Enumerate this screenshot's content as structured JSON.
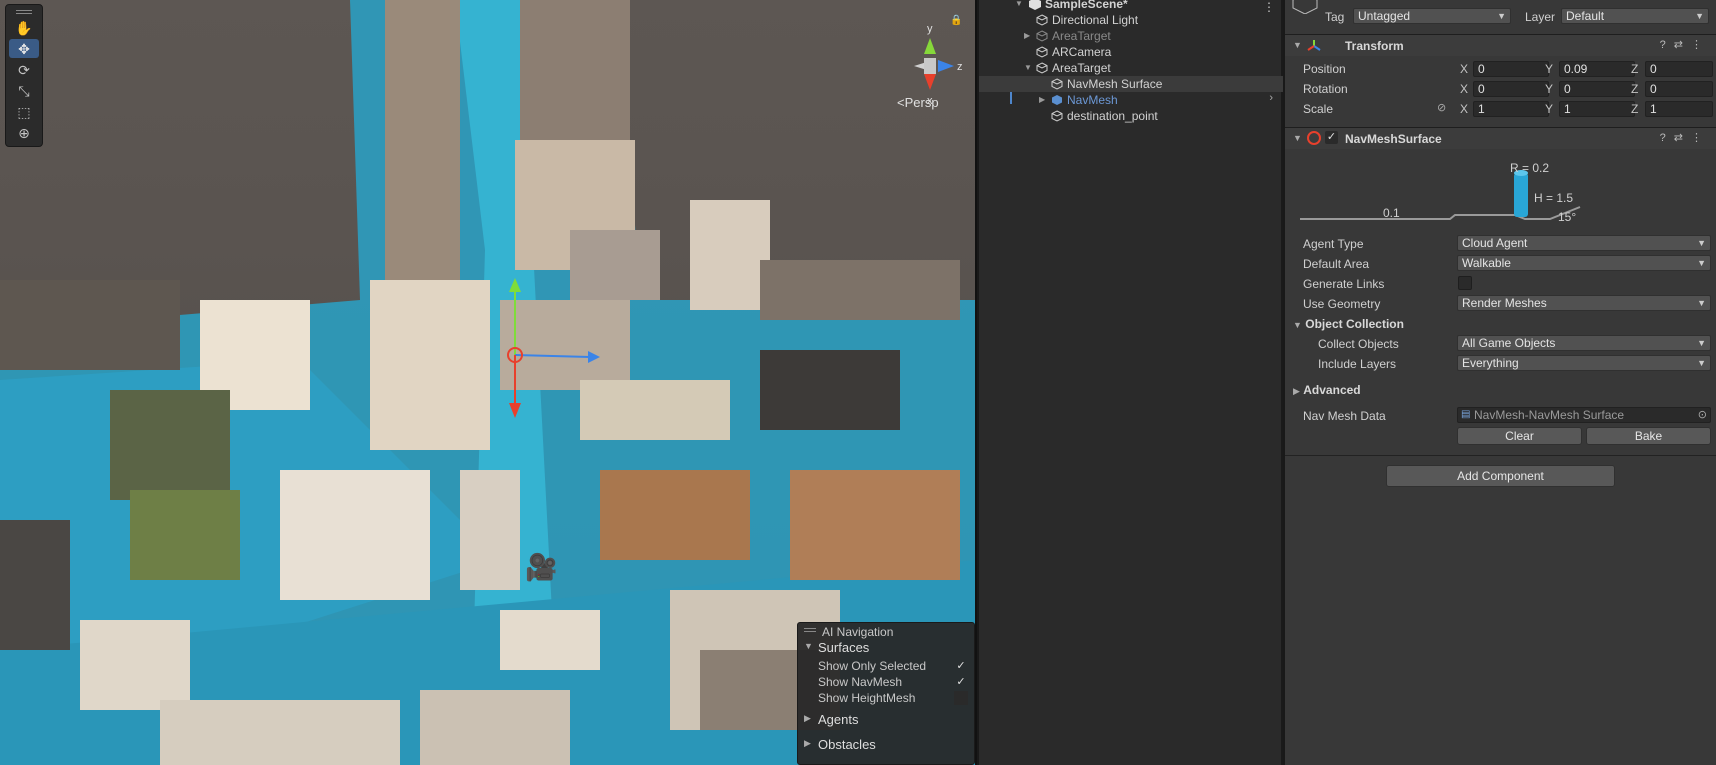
{
  "scene": {
    "tools": [
      "hand-tool",
      "move-tool",
      "rotate-tool",
      "scale-tool",
      "rect-tool",
      "transform-tool"
    ],
    "active_tool": "move-tool",
    "persp_label": "Persp",
    "gizmo_axes": {
      "y": "y",
      "z": "z",
      "x": "x"
    },
    "ai_navigation": {
      "title": "AI Navigation",
      "surfaces_label": "Surfaces",
      "rows": [
        {
          "label": "Show Only Selected",
          "checked": true
        },
        {
          "label": "Show NavMesh",
          "checked": true
        },
        {
          "label": "Show HeightMesh",
          "checked": false
        }
      ],
      "agents_label": "Agents",
      "obstacles_label": "Obstacles"
    }
  },
  "hierarchy": {
    "scene_name": "SampleScene*",
    "items": [
      {
        "label": "Directional Light"
      },
      {
        "label": "AreaTarget"
      },
      {
        "label": "ARCamera"
      },
      {
        "label": "AreaTarget"
      },
      {
        "label": "NavMesh Surface"
      },
      {
        "label": "NavMesh"
      },
      {
        "label": "destination_point"
      }
    ]
  },
  "inspector": {
    "tag_label": "Tag",
    "tag_value": "Untagged",
    "layer_label": "Layer",
    "layer_value": "Default",
    "transform": {
      "title": "Transform",
      "position_label": "Position",
      "rotation_label": "Rotation",
      "scale_label": "Scale",
      "position": {
        "x": "0",
        "y": "0.09",
        "z": "0"
      },
      "rotation": {
        "x": "0",
        "y": "0",
        "z": "0"
      },
      "scale": {
        "x": "1",
        "y": "1",
        "z": "1"
      },
      "axis_x": "X",
      "axis_y": "Y",
      "axis_z": "Z"
    },
    "navmesh_surface": {
      "title": "NavMeshSurface",
      "diagram": {
        "radius": "R = 0.2",
        "height": "H = 1.5",
        "step": "0.1",
        "slope": "15°"
      },
      "agent_type_label": "Agent Type",
      "agent_type": "Cloud Agent",
      "default_area_label": "Default Area",
      "default_area": "Walkable",
      "generate_links_label": "Generate Links",
      "use_geometry_label": "Use Geometry",
      "use_geometry": "Render Meshes",
      "object_collection_label": "Object Collection",
      "collect_objects_label": "Collect Objects",
      "collect_objects": "All Game Objects",
      "include_layers_label": "Include Layers",
      "include_layers": "Everything",
      "advanced_label": "Advanced",
      "nav_mesh_data_label": "Nav Mesh Data",
      "nav_mesh_data": "NavMesh-NavMesh Surface",
      "clear_label": "Clear",
      "bake_label": "Bake"
    },
    "add_component_label": "Add Component"
  },
  "colors": {
    "accent": "#3a5b86",
    "navmesh": "#2fa9c8",
    "prefab": "#6c98d6"
  }
}
